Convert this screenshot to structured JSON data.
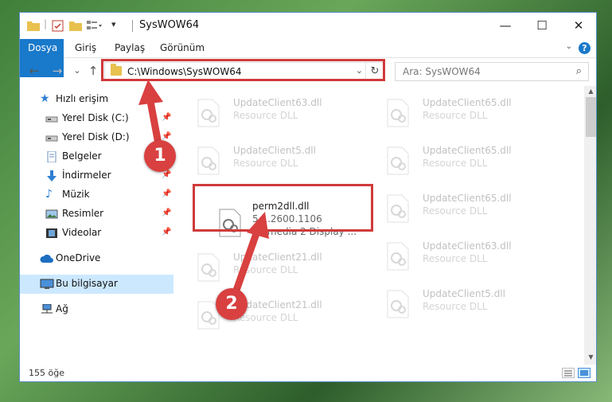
{
  "window": {
    "title": "SysWOW64",
    "minimize": "—",
    "maximize": "☐",
    "close": "✕"
  },
  "ribbon": {
    "tabs": [
      "Dosya",
      "Giriş",
      "Paylaş",
      "Görünüm"
    ],
    "help": "?"
  },
  "nav": {
    "back": "←",
    "forward": "→",
    "recent": "⌄",
    "up": "↑",
    "address": "C:\\Windows\\SysWOW64",
    "refresh": "↻",
    "search_placeholder": "Ara: SysWOW64"
  },
  "sidebar": {
    "items": [
      {
        "label": "Hızlı erişim",
        "icon": "star-icon",
        "pinned": false
      },
      {
        "label": "Yerel Disk (C:)",
        "icon": "drive-icon",
        "pinned": true
      },
      {
        "label": "Yerel Disk (D:)",
        "icon": "drive-icon",
        "pinned": true
      },
      {
        "label": "Belgeler",
        "icon": "documents-icon",
        "pinned": true
      },
      {
        "label": "İndirmeler",
        "icon": "download-icon",
        "pinned": true
      },
      {
        "label": "Müzik",
        "icon": "music-icon",
        "pinned": true
      },
      {
        "label": "Resimler",
        "icon": "pictures-icon",
        "pinned": true
      },
      {
        "label": "Videolar",
        "icon": "video-icon",
        "pinned": true
      },
      {
        "label": "OneDrive",
        "icon": "cloud-icon",
        "pinned": false
      },
      {
        "label": "Bu bilgisayar",
        "icon": "computer-icon",
        "pinned": false,
        "selected": true
      },
      {
        "label": "Ağ",
        "icon": "network-icon",
        "pinned": false
      }
    ]
  },
  "files": {
    "left": [
      {
        "name": "UpdateClient63.dll",
        "desc": "Resource DLL"
      },
      {
        "name": "UpdateClient5.dll",
        "desc": "Resource DLL"
      },
      {
        "name": "perm2dll.dll",
        "version": "5.1.2600.1106",
        "desc": "Permedia 2 Display ..."
      },
      {
        "name": "UpdateClient21.dll",
        "desc": "Resource DLL"
      },
      {
        "name": "UpdateClient21.dll",
        "desc": "Resource DLL"
      }
    ],
    "right": [
      {
        "name": "UpdateClient65.dll",
        "desc": "Resource DLL"
      },
      {
        "name": "UpdateClient65.dll",
        "desc": "Resource DLL"
      },
      {
        "name": "UpdateClient65.dll",
        "desc": "Resource DLL"
      },
      {
        "name": "UpdateClient63.dll",
        "desc": "Resource DLL"
      },
      {
        "name": "UpdateClient5.dll",
        "desc": "Resource DLL"
      }
    ]
  },
  "status": {
    "count": "155 öğe"
  },
  "annotations": {
    "badge1": "1",
    "badge2": "2",
    "color": "#d03a3a"
  }
}
